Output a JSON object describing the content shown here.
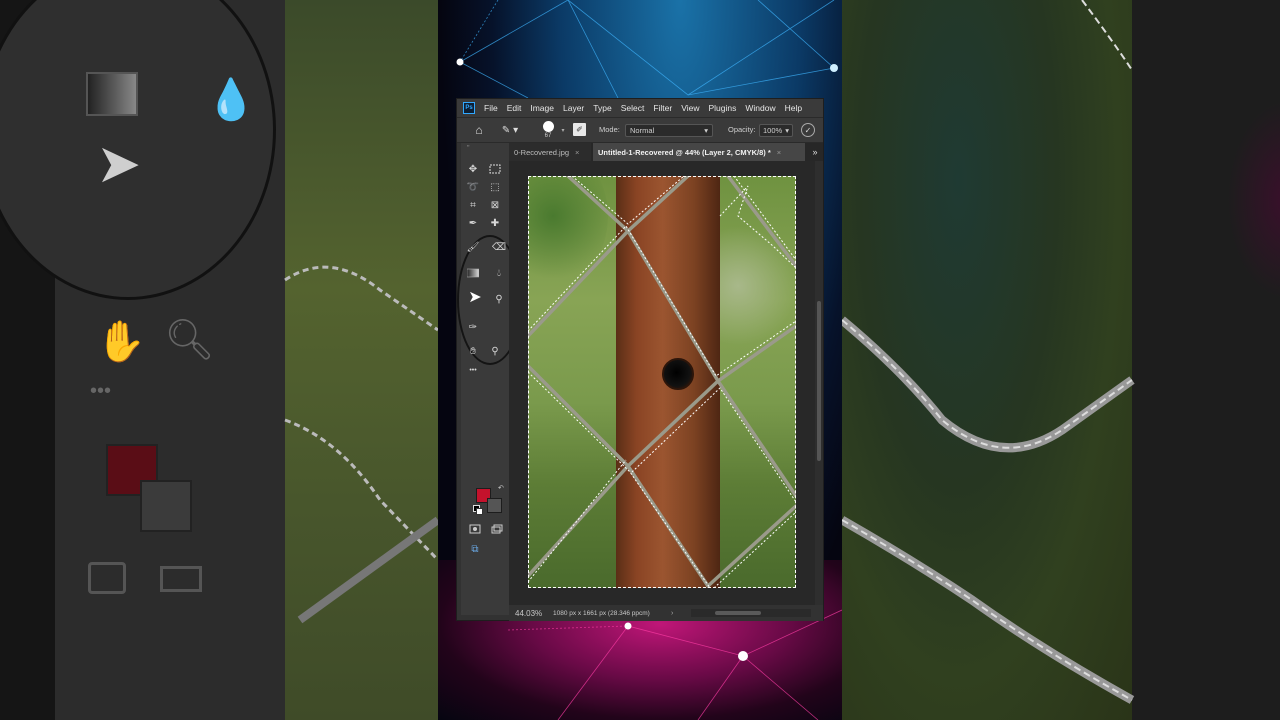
{
  "app": {
    "logo_text": "Ps"
  },
  "menu": [
    "File",
    "Edit",
    "Image",
    "Layer",
    "Type",
    "Select",
    "Filter",
    "View",
    "Plugins",
    "Window",
    "Help"
  ],
  "options": {
    "brush_size": "67",
    "mode_label": "Mode:",
    "mode_value": "Normal",
    "opacity_label": "Opacity:",
    "opacity_value": "100%"
  },
  "tabs": [
    {
      "label": "0-Recovered.jpg",
      "close": "×"
    },
    {
      "label": "Untitled-1-Recovered @ 44% (Layer 2, CMYK/8) *",
      "close": "×"
    }
  ],
  "tab_more": "»",
  "toolbar": {
    "grip": "\"",
    "more_tools": "•••",
    "foreground_color": "#C4122C",
    "background_color": "#555555"
  },
  "status": {
    "zoom": "44.03%",
    "doc_info": "1080 px x 1661 px (28.346 ppcm)",
    "arrow": "›"
  },
  "colors": {
    "ps_blue": "#31A8FF",
    "stage_blue": "#1A72A8",
    "stage_pink": "#C01678"
  }
}
